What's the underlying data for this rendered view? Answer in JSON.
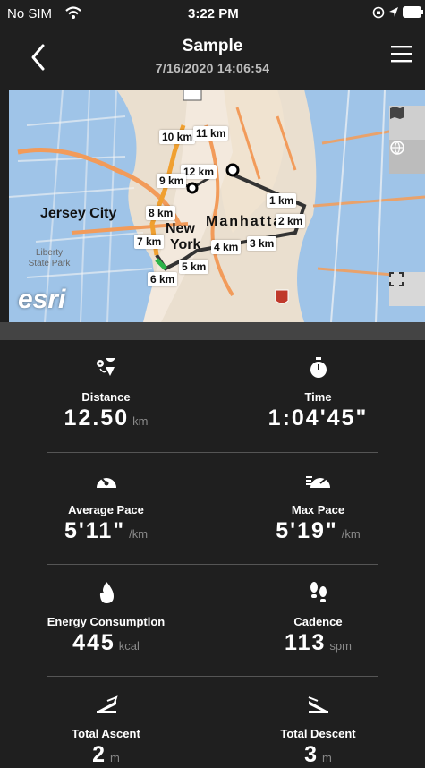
{
  "status": {
    "carrier": "No SIM",
    "time": "3:22 PM"
  },
  "header": {
    "title": "Sample",
    "subtitle": "7/16/2020 14:06:54"
  },
  "map": {
    "attribution": "esri",
    "place_labels": [
      "Jersey City",
      "Liberty State Park",
      "New",
      "Manhattan",
      "York"
    ],
    "km_markers": [
      "10 km",
      "11 km",
      "12 km",
      "9 km",
      "1 km",
      "8 km",
      "2 km",
      "7 km",
      "4 km",
      "3 km",
      "5 km",
      "6 km"
    ]
  },
  "stats": [
    {
      "label": "Distance",
      "value": "12.50",
      "unit": "km",
      "icon": "distance-icon"
    },
    {
      "label": "Time",
      "value": "1:04'45\"",
      "unit": "",
      "icon": "stopwatch-icon"
    },
    {
      "label": "Average Pace",
      "value": "5'11\"",
      "unit": "/km",
      "icon": "average-pace-icon"
    },
    {
      "label": "Max Pace",
      "value": "5'19\"",
      "unit": "/km",
      "icon": "max-pace-icon"
    },
    {
      "label": "Energy Consumption",
      "value": "445",
      "unit": "kcal",
      "icon": "flame-icon"
    },
    {
      "label": "Cadence",
      "value": "113",
      "unit": "spm",
      "icon": "footsteps-icon"
    },
    {
      "label": "Total Ascent",
      "value": "2",
      "unit": "m",
      "icon": "ascent-icon"
    },
    {
      "label": "Total Descent",
      "value": "3",
      "unit": "m",
      "icon": "descent-icon"
    }
  ],
  "colors": {
    "background": "#1f1f1f",
    "route": "#f0a030",
    "accent_green": "#2db34a"
  }
}
